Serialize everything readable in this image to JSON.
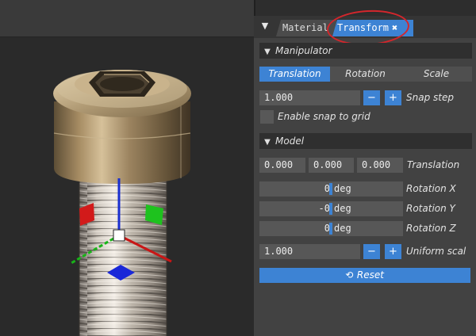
{
  "tabs": {
    "menu_icon": "hamburger-icon",
    "items": [
      {
        "label": "Material"
      },
      {
        "label": "Transform",
        "close_icon": "close-icon"
      }
    ],
    "active": "Transform",
    "highlight_color": "#d3262c"
  },
  "manipulator": {
    "title": "Manipulator",
    "modes": [
      "Translation",
      "Rotation",
      "Scale"
    ],
    "active_mode": "Translation",
    "snap_value": "1.000",
    "minus_label": "−",
    "plus_label": "+",
    "snap_label": "Snap step",
    "snap_grid_label": "Enable snap to grid",
    "snap_grid_checked": false
  },
  "model": {
    "title": "Model",
    "translation": [
      "0.000",
      "0.000",
      "0.000"
    ],
    "translation_label": "Translation",
    "rotation": [
      {
        "value": "0",
        "unit": "deg",
        "label": "Rotation X"
      },
      {
        "value": "-0",
        "unit": "deg",
        "label": "Rotation Y"
      },
      {
        "value": "0",
        "unit": "deg",
        "label": "Rotation Z"
      }
    ],
    "scale_value": "1.000",
    "minus_label": "−",
    "plus_label": "+",
    "scale_label": "Uniform scal",
    "reset_label": "Reset",
    "reset_icon": "undo-icon"
  },
  "colors": {
    "accent": "#3d83d4",
    "panel_bg": "#424242",
    "header_bg": "#2f2f2f"
  }
}
